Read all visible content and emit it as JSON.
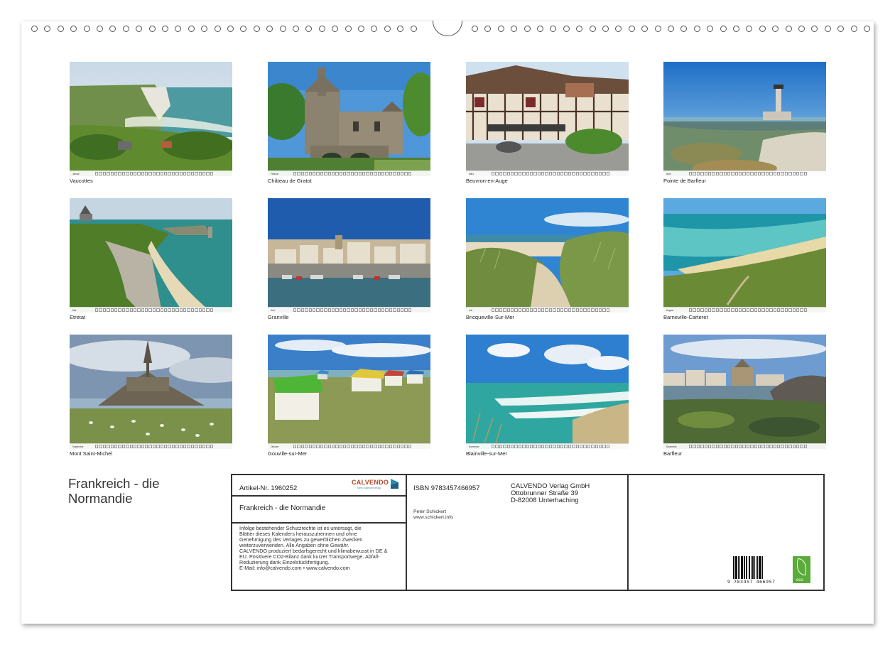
{
  "calendar": {
    "title": "Frankreich - die Normandie",
    "months": [
      {
        "label": "Januar",
        "caption": "Vaucottes",
        "scene": "cliff-coast"
      },
      {
        "label": "Februar",
        "caption": "Château de Gratot",
        "scene": "castle"
      },
      {
        "label": "März",
        "caption": "Beuvron-en-Auge",
        "scene": "village"
      },
      {
        "label": "April",
        "caption": "Pointe de Barfleur",
        "scene": "lighthouse"
      },
      {
        "label": "Mai",
        "caption": "Etretat",
        "scene": "cliffs"
      },
      {
        "label": "Juni",
        "caption": "Granville",
        "scene": "harbour"
      },
      {
        "label": "Juli",
        "caption": "Bricqueville-Sur-Mer",
        "scene": "dunes"
      },
      {
        "label": "August",
        "caption": "Barneville-Carteret",
        "scene": "bay"
      },
      {
        "label": "September",
        "caption": "Mont Saint-Michel",
        "scene": "abbey"
      },
      {
        "label": "Oktober",
        "caption": "Gouville-sur-Mer",
        "scene": "beach-huts"
      },
      {
        "label": "November",
        "caption": "Blainville-sur-Mer",
        "scene": "surf"
      },
      {
        "label": "Dezember",
        "caption": "Barfleur",
        "scene": "rocky-port"
      }
    ]
  },
  "imprint": {
    "article": "Artikel-Nr. 1960252",
    "brand": "CALVENDO",
    "brand_tagline": "Mein Kalenderverlag",
    "book_title": "Frankreich - die Normandie",
    "legal_lines": [
      "Infolge bestehender Schutzrechte ist es untersagt, die",
      "Blätter dieses Kalenders herauszutrennen und ohne",
      "Genehmigung des Verlages zu gewerblichen Zwecken",
      "weiterzuverwenden. Alle Angaben ohne Gewähr.",
      "CALVENDO produziert bedarfsgerecht und klimabewusst in DE &",
      "EU. Positivere CO2-Bilanz dank kurzer Transportwege. Abfall-",
      "Reduzierung dank Einzelstückfertigung.",
      "E-Mail: info@calvendo.com • www.calvendo.com"
    ],
    "isbn": "ISBN 9783457466957",
    "author": "Peter Schickert",
    "author_site": "www.schickert.info",
    "publisher_lines": [
      "CALVENDO Verlag GmbH",
      "Ottobrunner Straße 39",
      "D-82008 Unterhaching"
    ],
    "ean_digits": "9  783457  466957",
    "eco_label": "eco"
  },
  "colors": {
    "frame": "#333333",
    "brand_red": "#b8462a",
    "brand_blue": "#2a8bb3",
    "eco_green": "#5aab3a"
  }
}
